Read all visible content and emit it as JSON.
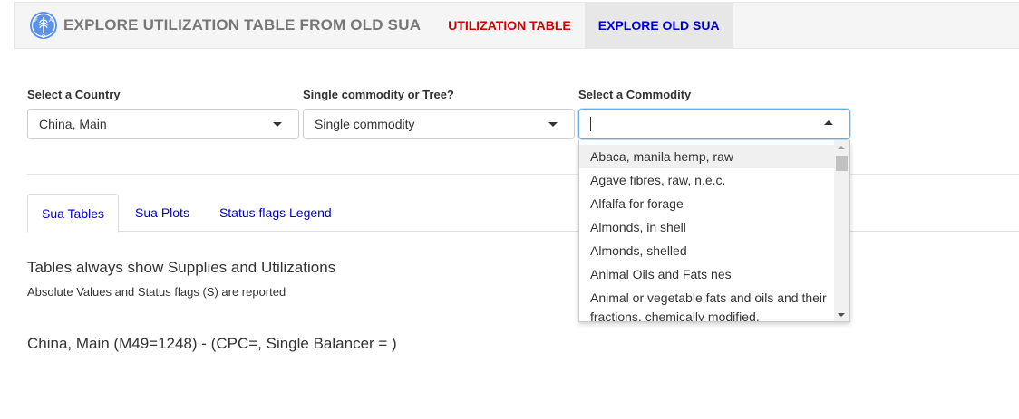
{
  "navbar": {
    "logo_icon": "fao-logo-icon",
    "title": "EXPLORE UTILIZATION TABLE FROM OLD SUA",
    "tabs": [
      {
        "label": "UTILIZATION TABLE",
        "color": "#cc0000"
      },
      {
        "label": "EXPLORE OLD SUA",
        "color": "#0000cc",
        "active": true
      }
    ]
  },
  "controls": {
    "country": {
      "label": "Select a Country",
      "value": "China, Main"
    },
    "mode": {
      "label": "Single commodity or Tree?",
      "value": "Single commodity"
    },
    "commodity": {
      "label": "Select a Commodity",
      "value": ""
    }
  },
  "commodity_options": [
    "Abaca, manila hemp, raw",
    "Agave fibres, raw, n.e.c.",
    "Alfalfa for forage",
    "Almonds, in shell",
    "Almonds, shelled",
    "Animal Oils and Fats nes",
    "Animal or vegetable fats and oils and their fractions, chemically modified,"
  ],
  "tabs": [
    {
      "label": "Sua Tables",
      "active": true
    },
    {
      "label": "Sua Plots"
    },
    {
      "label": "Status flags Legend"
    }
  ],
  "content": {
    "heading": "Tables always show Supplies and Utilizations",
    "subtext": "Absolute Values and Status flags (S) are reported",
    "country_line": "China, Main (M49=1248) - (CPC=, Single Balancer = )"
  },
  "colors": {
    "link_blue": "#0000cc",
    "accent_red": "#cc0000",
    "focus_blue": "#66afe9"
  }
}
